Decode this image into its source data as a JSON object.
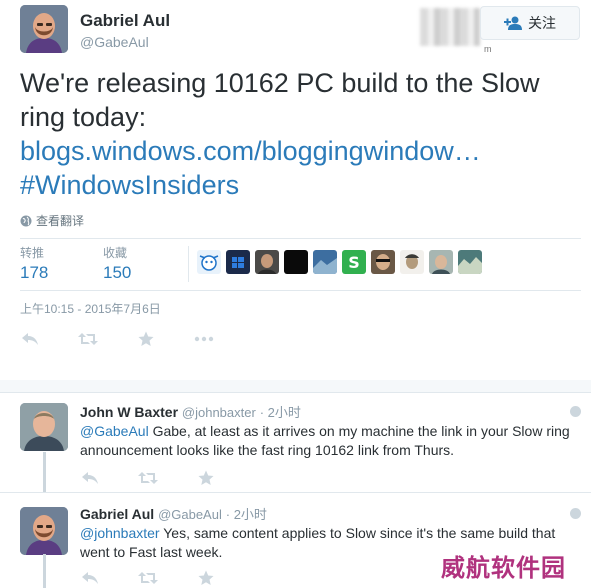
{
  "tweet": {
    "author_name": "Gabriel Aul",
    "author_handle": "@GabeAul",
    "follow_label": "关注",
    "text_line1": "We're releasing 10162 PC build to the Slow",
    "text_line2": "ring today:",
    "link": "blogs.windows.com/bloggingwindow…",
    "hashtag": "#WindowsInsiders",
    "translate_label": "查看翻译",
    "retweets_label": "转推",
    "retweets_count": "178",
    "favorites_label": "收藏",
    "favorites_count": "150",
    "timestamp": "上午10:15 - 2015年7月6日"
  },
  "favoriters": [
    {
      "icon": "cartoon-avatar",
      "color": "#e8f2fb"
    },
    {
      "icon": "windows-logo-avatar",
      "color": "#1b2a4a"
    },
    {
      "icon": "person-avatar",
      "color": "#4b4a48"
    },
    {
      "icon": "black-avatar",
      "color": "#0a0a0a"
    },
    {
      "icon": "landscape-avatar",
      "color": "#3d6ea0"
    },
    {
      "icon": "s-logo-avatar",
      "color": "#31b04f"
    },
    {
      "icon": "person-sunglasses-avatar",
      "color": "#6a5846"
    },
    {
      "icon": "person-avatar",
      "color": "#b39b7c"
    },
    {
      "icon": "person-avatar",
      "color": "#a7b6b2"
    },
    {
      "icon": "landscape-avatar",
      "color": "#4d7a7a"
    }
  ],
  "replies": [
    {
      "name": "John W Baxter",
      "handle": "@johnbaxter",
      "time": "· 2小时",
      "mention": "@GabeAul",
      "text": " Gabe, at least as it arrives on my machine the link in your Slow ring announcement looks like the fast ring 10162 link from Thurs."
    },
    {
      "name": "Gabriel Aul",
      "handle": "@GabeAul",
      "time": "· 2小时",
      "mention": "@johnbaxter",
      "text": " Yes, same content applies to Slow since it's the same build that went to Fast last week."
    }
  ],
  "watermark": "威航软件园",
  "colors": {
    "link": "#2b7bb9",
    "muted": "#8899a6",
    "border": "#e1e8ed",
    "watermark": "#b0327e"
  }
}
